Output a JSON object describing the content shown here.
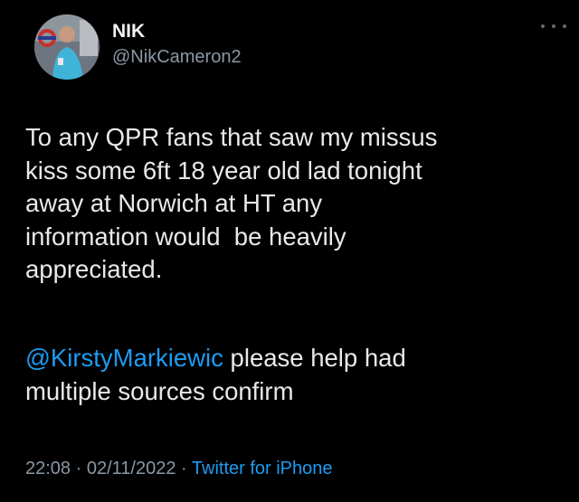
{
  "user": {
    "display_name": "NIK",
    "handle": "@NikCameron2"
  },
  "tweet": {
    "body": "To any QPR fans that saw my missus\nkiss some 6ft 18 year old lad tonight\naway at Norwich at HT any\ninformation would  be heavily\nappreciated.",
    "mention": "@KirstyMarkiewic",
    "reply_text_1": " please help had",
    "reply_text_2": "multiple sources confirm"
  },
  "meta": {
    "time": "22:08",
    "separator_1": " · ",
    "date": "02/11/2022",
    "separator_2": " · ",
    "source": "Twitter for iPhone"
  },
  "icons": {
    "more": "more-options-icon"
  },
  "colors": {
    "background": "#000000",
    "text": "#e7e9ea",
    "muted": "#8b98a5",
    "link": "#1d9bf0"
  }
}
